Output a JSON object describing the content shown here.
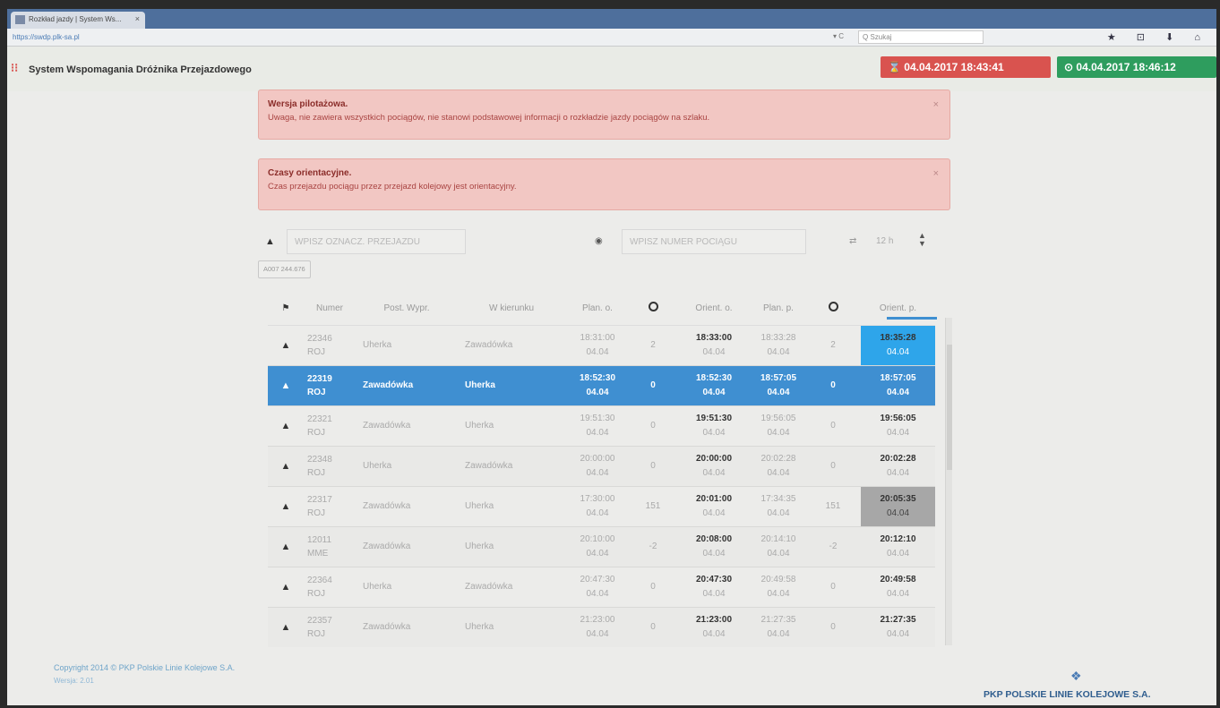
{
  "browser": {
    "tab_title": "Rozkład jazdy | System Ws...",
    "tab_close": "×",
    "url": "https://swdp.plk-sa.pl",
    "reload": "▾ C",
    "search_placeholder": "Q Szukaj",
    "icons": "★ ⊡ ⬇ ⌂"
  },
  "header": {
    "logo": "⁝⁝",
    "title": "System Wspomagania Dróżnika Przejazdowego",
    "time_red": "⌛ 04.04.2017 18:43:41",
    "time_green": "⊙ 04.04.2017 18:46:12"
  },
  "alerts": [
    {
      "title": "Wersja pilotażowa.",
      "text": "Uwaga, nie zawiera wszystkich pociągów, nie stanowi podstawowej informacji o rozkładzie jazdy pociągów na szlaku.",
      "close": "×"
    },
    {
      "title": "Czasy orientacyjne.",
      "text": "Czas przejazdu pociągu przez przejazd kolejowy jest orientacyjny.",
      "close": "×"
    }
  ],
  "filters": {
    "crossing_placeholder": "WPISZ OZNACZ. PRZEJAZDU",
    "train_placeholder": "WPISZ NUMER POCIĄGU",
    "hours": "12 h",
    "crossing_tag": "A007 244.676"
  },
  "table": {
    "headers": [
      "",
      "Numer",
      "Post. Wypr.",
      "W kierunku",
      "Plan. o.",
      "",
      "Orient. o.",
      "Plan. p.",
      "",
      "Orient. p."
    ],
    "rows": [
      {
        "num": "22346",
        "cat": "ROJ",
        "from": "Uherka",
        "to": "Zawadówka",
        "plan_o": "18:31:00",
        "d1": "2",
        "orient_o": "18:33:00",
        "plan_p": "18:33:28",
        "d2": "2",
        "orient_p": "18:35:28",
        "date": "04.04"
      },
      {
        "num": "22319",
        "cat": "ROJ",
        "from": "Zawadówka",
        "to": "Uherka",
        "plan_o": "18:52:30",
        "d1": "0",
        "orient_o": "18:52:30",
        "plan_p": "18:57:05",
        "d2": "0",
        "orient_p": "18:57:05",
        "date": "04.04"
      },
      {
        "num": "22321",
        "cat": "ROJ",
        "from": "Zawadówka",
        "to": "Uherka",
        "plan_o": "19:51:30",
        "d1": "0",
        "orient_o": "19:51:30",
        "plan_p": "19:56:05",
        "d2": "0",
        "orient_p": "19:56:05",
        "date": "04.04"
      },
      {
        "num": "22348",
        "cat": "ROJ",
        "from": "Uherka",
        "to": "Zawadówka",
        "plan_o": "20:00:00",
        "d1": "0",
        "orient_o": "20:00:00",
        "plan_p": "20:02:28",
        "d2": "0",
        "orient_p": "20:02:28",
        "date": "04.04"
      },
      {
        "num": "22317",
        "cat": "ROJ",
        "from": "Zawadówka",
        "to": "Uherka",
        "plan_o": "17:30:00",
        "d1": "151",
        "orient_o": "20:01:00",
        "plan_p": "17:34:35",
        "d2": "151",
        "orient_p": "20:05:35",
        "date": "04.04"
      },
      {
        "num": "12011",
        "cat": "MME",
        "from": "Zawadówka",
        "to": "Uherka",
        "plan_o": "20:10:00",
        "d1": "-2",
        "orient_o": "20:08:00",
        "plan_p": "20:14:10",
        "d2": "-2",
        "orient_p": "20:12:10",
        "date": "04.04"
      },
      {
        "num": "22364",
        "cat": "ROJ",
        "from": "Uherka",
        "to": "Zawadówka",
        "plan_o": "20:47:30",
        "d1": "0",
        "orient_o": "20:47:30",
        "plan_p": "20:49:58",
        "d2": "0",
        "orient_p": "20:49:58",
        "date": "04.04"
      },
      {
        "num": "22357",
        "cat": "ROJ",
        "from": "Zawadówka",
        "to": "Uherka",
        "plan_o": "21:23:00",
        "d1": "0",
        "orient_o": "21:23:00",
        "plan_p": "21:27:35",
        "d2": "0",
        "orient_p": "21:27:35",
        "date": "04.04"
      }
    ]
  },
  "footer": {
    "copyright": "Copyright 2014 © PKP Polskie Linie Kolejowe S.A.",
    "version": "Wersja: 2.01",
    "company": "PKP POLSKIE LINIE KOLEJOWE S.A."
  }
}
